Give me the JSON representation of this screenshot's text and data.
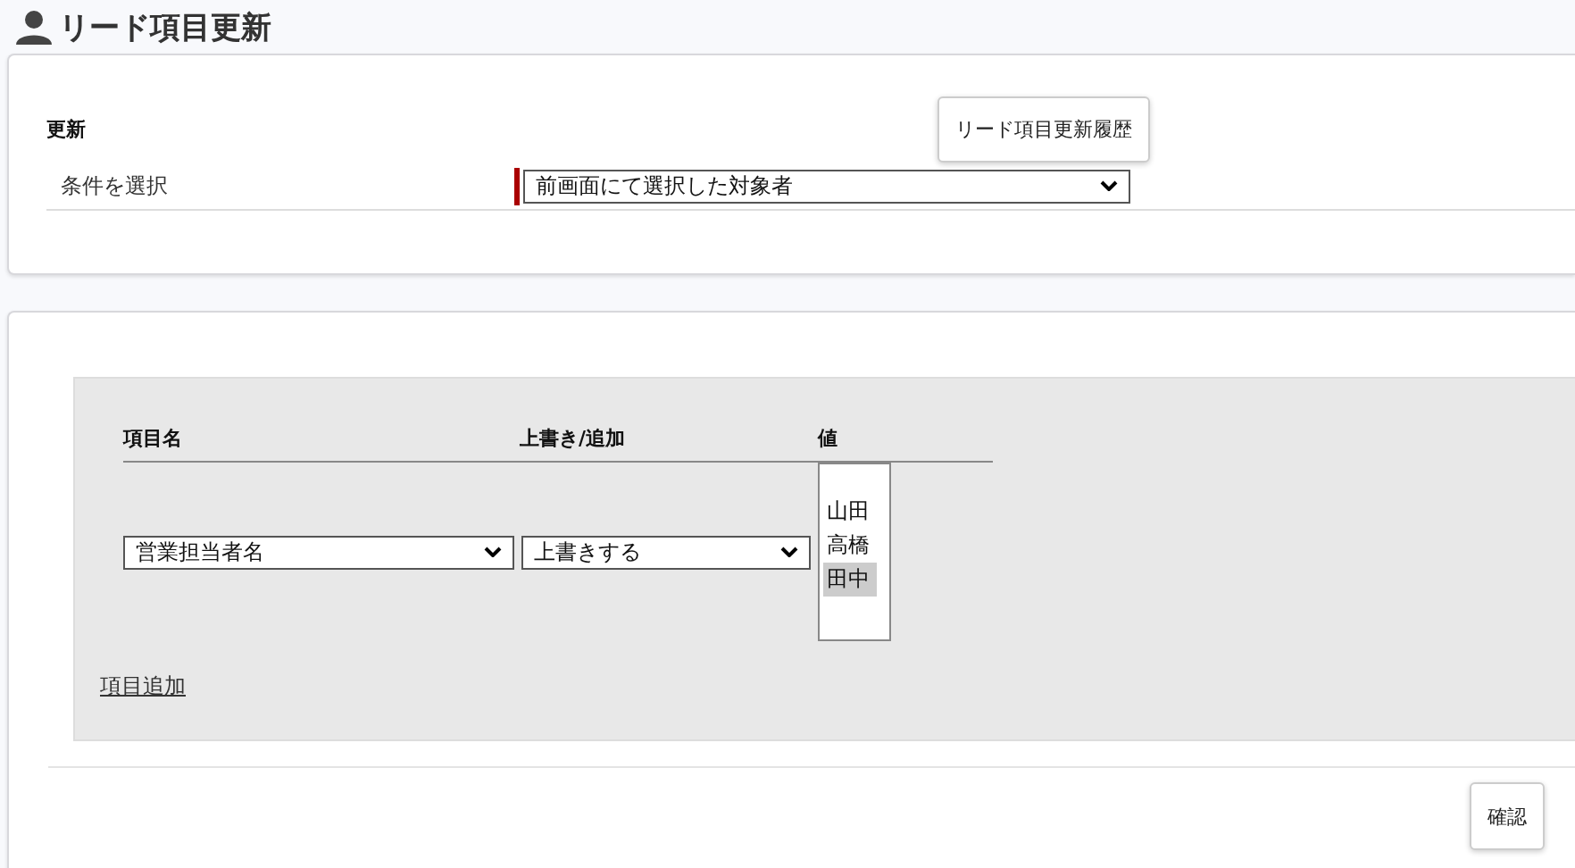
{
  "page_title": "リード項目更新",
  "update_section": {
    "heading": "更新",
    "history_button": "リード項目更新履歴",
    "condition_label": "条件を選択",
    "condition_value": "前画面にて選択した対象者",
    "required": true
  },
  "table": {
    "columns": [
      "項目名",
      "上書き/追加",
      "値"
    ],
    "rows": [
      {
        "field": "営業担当者名",
        "mode": "上書きする",
        "values": [
          {
            "label": "山田",
            "selected": false
          },
          {
            "label": "高橋",
            "selected": false
          },
          {
            "label": "田中",
            "selected": true
          }
        ]
      }
    ]
  },
  "add_link": "項目追加",
  "confirm_button": "確認"
}
